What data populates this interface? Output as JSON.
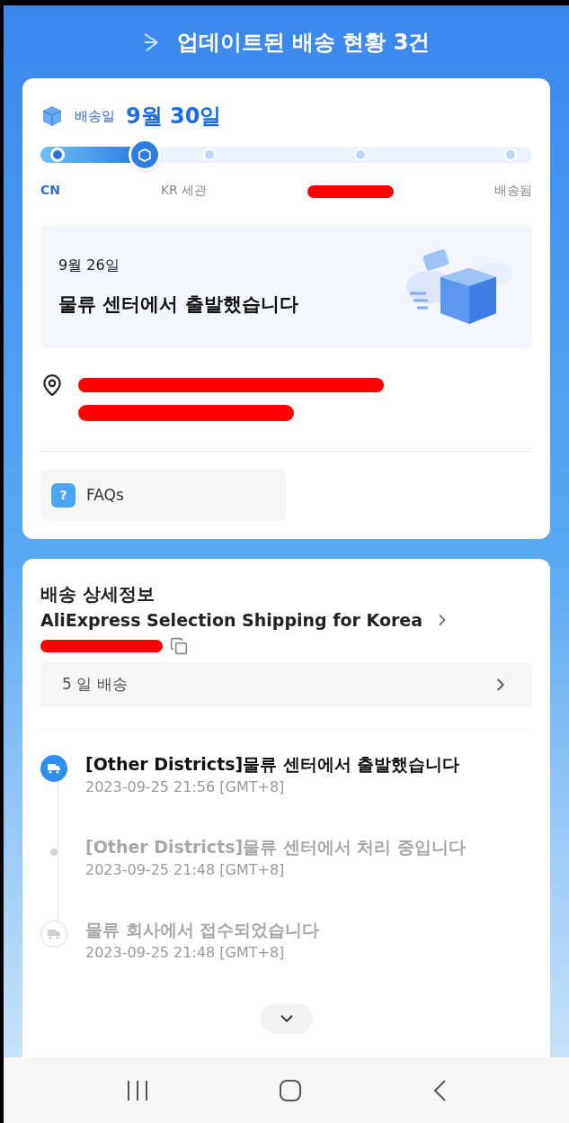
{
  "header": {
    "title": "업데이트된 배송 현황 3건"
  },
  "summary": {
    "label": "배송일",
    "date": "9월 30일",
    "progress": {
      "level": 0.2,
      "steps": [
        {
          "kind": "done",
          "label": "CN"
        },
        {
          "kind": "current"
        },
        {
          "kind": "pending",
          "label": "KR 세관"
        },
        {
          "kind": "pending",
          "label_redacted": true
        },
        {
          "kind": "pending",
          "label": "배송됨"
        }
      ]
    }
  },
  "latest_event": {
    "date": "9월 26일",
    "message": "물류 센터에서 출발했습니다"
  },
  "faq": {
    "icon": "?",
    "label": "FAQs"
  },
  "details": {
    "title": "배송 상세정보",
    "carrier": "AliExpress Selection Shipping for Korea",
    "delivery": "5 일 배송",
    "events": [
      {
        "kind": "truck",
        "selected": true,
        "message": "[Other Districts]물류 센터에서 출발했습니다",
        "time": "2023-09-25 21:56 [GMT+8]"
      },
      {
        "kind": "dot",
        "selected": false,
        "message": "[Other Districts]물류 센터에서 처리 중입니다",
        "time": "2023-09-25 21:48 [GMT+8]"
      },
      {
        "kind": "truck",
        "selected": false,
        "message": "물류 회사에서 접수되었습니다",
        "time": "2023-09-25 21:48 [GMT+8]"
      }
    ]
  }
}
